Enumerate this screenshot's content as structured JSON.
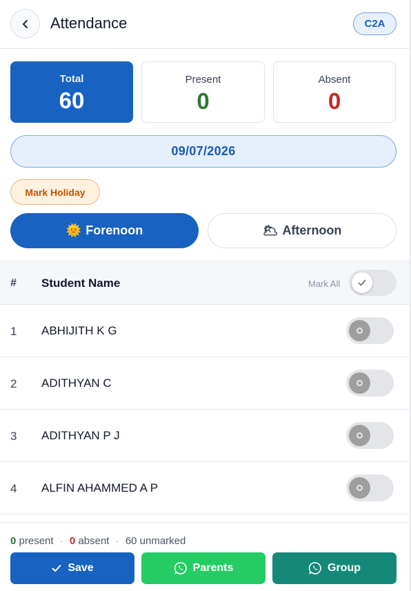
{
  "header": {
    "title": "Attendance",
    "class_badge": "C2A"
  },
  "stats": {
    "total_label": "Total",
    "total_value": "60",
    "present_label": "Present",
    "present_value": "0",
    "absent_label": "Absent",
    "absent_value": "0"
  },
  "date": "09/07/2026",
  "mark_holiday_label": "Mark Holiday",
  "sessions": {
    "forenoon_icon": "🌞",
    "forenoon_label": "Forenoon",
    "afternoon_icon": "🌥",
    "afternoon_label": "Afternoon",
    "selected": "Forenoon"
  },
  "table": {
    "col_num": "#",
    "col_name": "Student Name",
    "mark_all_label": "Mark All",
    "mark_all_checked": false
  },
  "students": [
    {
      "num": "1",
      "name": "ABHIJITH K G",
      "marked": false
    },
    {
      "num": "2",
      "name": "ADITHYAN C",
      "marked": false
    },
    {
      "num": "3",
      "name": "ADITHYAN P J",
      "marked": false
    },
    {
      "num": "4",
      "name": "ALFIN AHAMMED A P",
      "marked": false
    }
  ],
  "footer": {
    "present_count": "0",
    "present_text": "present",
    "absent_count": "0",
    "absent_text": "absent",
    "unmarked_text": "60 unmarked",
    "separator": "·",
    "save_label": "Save",
    "parents_label": "Parents",
    "group_label": "Group"
  },
  "colors": {
    "primary": "#1862c1",
    "present": "#2c7a31",
    "absent": "#c62828",
    "whatsapp": "#25cc64",
    "group": "#14897a"
  },
  "icons": {
    "back": "chevron-left-icon",
    "save": "check-icon",
    "parents": "whatsapp-icon",
    "group": "whatsapp-icon",
    "mark_all": "check-icon"
  }
}
